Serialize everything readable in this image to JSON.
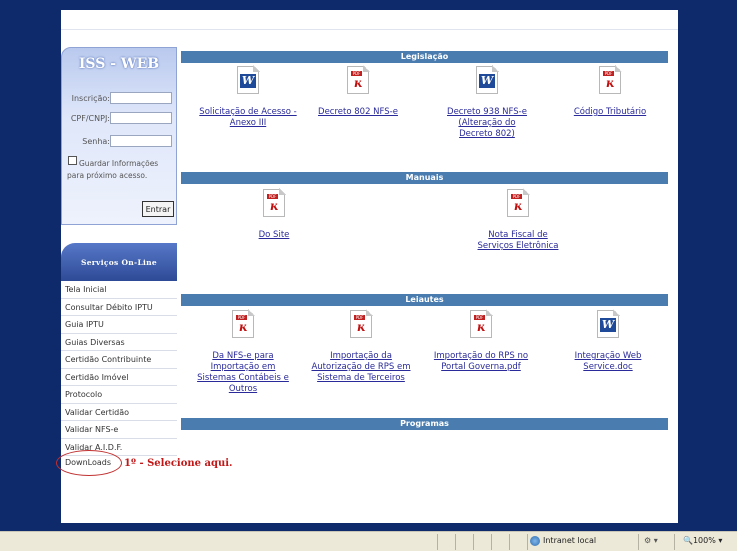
{
  "login": {
    "title": "ISS - WEB",
    "inscricao_label": "Inscrição:",
    "cpf_label": "CPF/CNPJ:",
    "senha_label": "Senha:",
    "remember": "Guardar Informações para próximo acesso.",
    "submit": "Entrar"
  },
  "services": {
    "title": "Serviços On-Line",
    "items": [
      "Tela Inicial",
      "Consultar Débito IPTU",
      "Guia IPTU",
      "Guias Diversas",
      "Certidão Contribuinte",
      "Certidão Imóvel",
      "Protocolo",
      "Validar Certidão",
      "Validar NFS-e",
      "Validar A.I.D.F."
    ],
    "downloads": "DownLoads"
  },
  "annotation": "1º - Selecione aqui.",
  "sections": {
    "legislacao": "Legislação",
    "manuais": "Manuais",
    "leiautes": "Leiautes",
    "programas": "Programas"
  },
  "legislacao_items": [
    {
      "label": "Solicitação de Acesso - Anexo III",
      "icon": "word-doc-icon"
    },
    {
      "label": "Decreto 802 NFS-e",
      "icon": "pdf-icon"
    },
    {
      "label": "Decreto 938 NFS-e (Alteração do Decreto 802)",
      "icon": "word-doc-icon"
    },
    {
      "label": "Código Tributário",
      "icon": "pdf-icon"
    }
  ],
  "manuais_items": [
    {
      "label": "Do Site",
      "icon": "pdf-icon"
    },
    {
      "label": "Nota Fiscal de Serviços Eletrônica",
      "icon": "pdf-icon"
    }
  ],
  "leiautes_items": [
    {
      "label": "Da NFS-e para Importação em Sistemas Contábeis e Outros",
      "icon": "pdf-icon"
    },
    {
      "label": "Importação da Autorização de RPS em Sistema de Terceiros",
      "icon": "pdf-icon"
    },
    {
      "label": "Importação do RPS no Portal Governa.pdf",
      "icon": "pdf-icon"
    },
    {
      "label": "Integração Web Service.doc",
      "icon": "word-doc-icon"
    }
  ],
  "statusbar": {
    "zone": "Intranet local",
    "zoom": "100%"
  }
}
